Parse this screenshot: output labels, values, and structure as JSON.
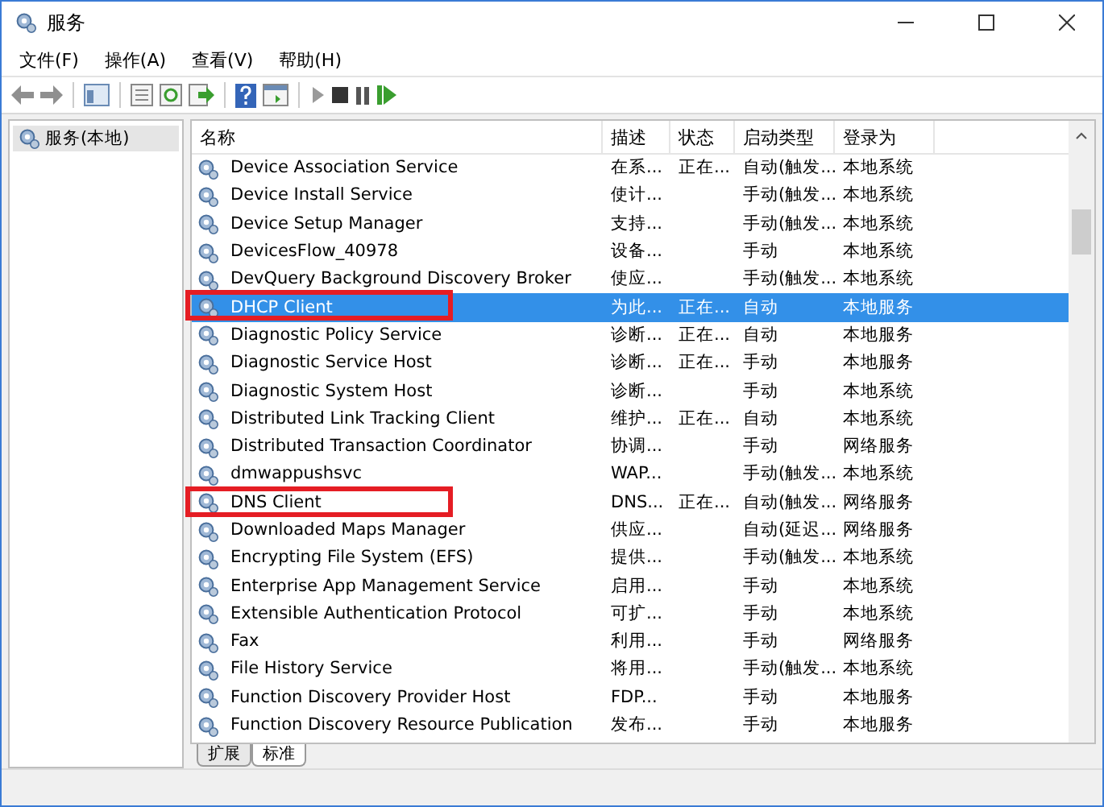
{
  "window": {
    "title": "服务"
  },
  "menu": [
    "文件(F)",
    "操作(A)",
    "查看(V)",
    "帮助(H)"
  ],
  "tree": {
    "items": [
      {
        "label": "服务(本地)",
        "selected": true
      }
    ]
  },
  "table": {
    "columns": [
      "名称",
      "描述",
      "状态",
      "启动类型",
      "登录为"
    ],
    "rows": [
      {
        "name": "Device Association Service",
        "description": "在系...",
        "status": "正在...",
        "startup": "自动(触发...",
        "logon": "本地系统",
        "selected": false,
        "outlined": false
      },
      {
        "name": "Device Install Service",
        "description": "使计...",
        "status": "",
        "startup": "手动(触发...",
        "logon": "本地系统",
        "selected": false,
        "outlined": false
      },
      {
        "name": "Device Setup Manager",
        "description": "支持...",
        "status": "",
        "startup": "手动(触发...",
        "logon": "本地系统",
        "selected": false,
        "outlined": false
      },
      {
        "name": "DevicesFlow_40978",
        "description": "设备...",
        "status": "",
        "startup": "手动",
        "logon": "本地系统",
        "selected": false,
        "outlined": false
      },
      {
        "name": "DevQuery Background Discovery Broker",
        "description": "使应...",
        "status": "",
        "startup": "手动(触发...",
        "logon": "本地系统",
        "selected": false,
        "outlined": false
      },
      {
        "name": "DHCP Client",
        "description": "为此...",
        "status": "正在...",
        "startup": "自动",
        "logon": "本地服务",
        "selected": true,
        "outlined": true
      },
      {
        "name": "Diagnostic Policy Service",
        "description": "诊断...",
        "status": "正在...",
        "startup": "自动",
        "logon": "本地服务",
        "selected": false,
        "outlined": false
      },
      {
        "name": "Diagnostic Service Host",
        "description": "诊断...",
        "status": "正在...",
        "startup": "手动",
        "logon": "本地服务",
        "selected": false,
        "outlined": false
      },
      {
        "name": "Diagnostic System Host",
        "description": "诊断...",
        "status": "",
        "startup": "手动",
        "logon": "本地系统",
        "selected": false,
        "outlined": false
      },
      {
        "name": "Distributed Link Tracking Client",
        "description": "维护...",
        "status": "正在...",
        "startup": "自动",
        "logon": "本地系统",
        "selected": false,
        "outlined": false
      },
      {
        "name": "Distributed Transaction Coordinator",
        "description": "协调...",
        "status": "",
        "startup": "手动",
        "logon": "网络服务",
        "selected": false,
        "outlined": false
      },
      {
        "name": "dmwappushsvc",
        "description": "WAP...",
        "status": "",
        "startup": "手动(触发...",
        "logon": "本地系统",
        "selected": false,
        "outlined": false
      },
      {
        "name": "DNS Client",
        "description": "DNS...",
        "status": "正在...",
        "startup": "自动(触发...",
        "logon": "网络服务",
        "selected": false,
        "outlined": true
      },
      {
        "name": "Downloaded Maps Manager",
        "description": "供应...",
        "status": "",
        "startup": "自动(延迟...",
        "logon": "网络服务",
        "selected": false,
        "outlined": false
      },
      {
        "name": "Encrypting File System (EFS)",
        "description": "提供...",
        "status": "",
        "startup": "手动(触发...",
        "logon": "本地系统",
        "selected": false,
        "outlined": false
      },
      {
        "name": "Enterprise App Management Service",
        "description": "启用...",
        "status": "",
        "startup": "手动",
        "logon": "本地系统",
        "selected": false,
        "outlined": false
      },
      {
        "name": "Extensible Authentication Protocol",
        "description": "可扩...",
        "status": "",
        "startup": "手动",
        "logon": "本地系统",
        "selected": false,
        "outlined": false
      },
      {
        "name": "Fax",
        "description": "利用...",
        "status": "",
        "startup": "手动",
        "logon": "网络服务",
        "selected": false,
        "outlined": false
      },
      {
        "name": "File History Service",
        "description": "将用...",
        "status": "",
        "startup": "手动(触发...",
        "logon": "本地系统",
        "selected": false,
        "outlined": false
      },
      {
        "name": "Function Discovery Provider Host",
        "description": "FDP...",
        "status": "",
        "startup": "手动",
        "logon": "本地服务",
        "selected": false,
        "outlined": false
      },
      {
        "name": "Function Discovery Resource Publication",
        "description": "发布...",
        "status": "",
        "startup": "手动",
        "logon": "本地服务",
        "selected": false,
        "outlined": false
      }
    ]
  },
  "view_tabs": [
    {
      "label": "扩展",
      "selected": false
    },
    {
      "label": "标准",
      "selected": true
    }
  ]
}
